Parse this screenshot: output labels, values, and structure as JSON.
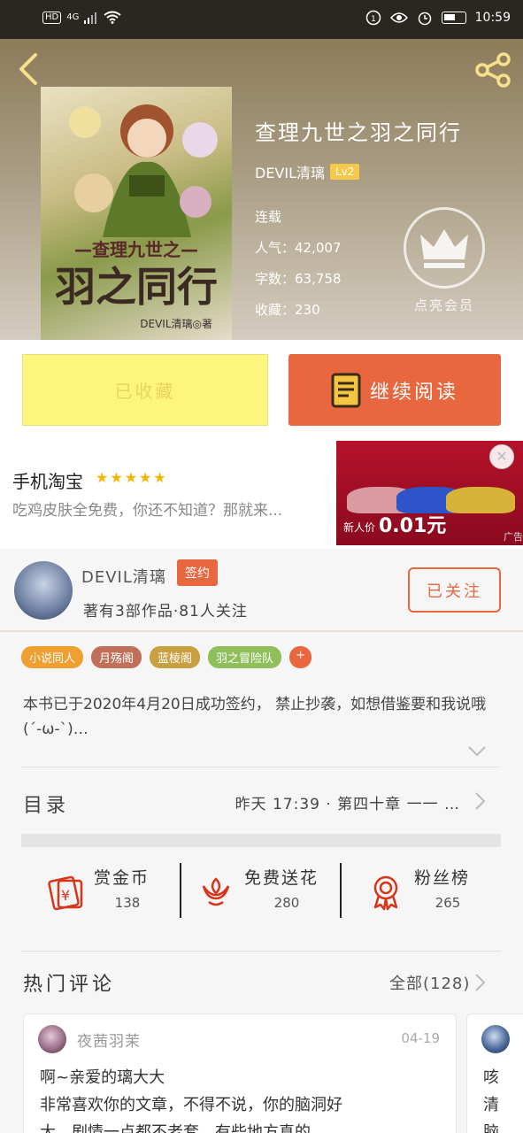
{
  "status_bar": {
    "left": [
      "HD",
      "4G"
    ],
    "time": "10:59"
  },
  "book": {
    "title": "查理九世之羽之同行",
    "author": "DEVIL清璃",
    "level": "Lv2",
    "status": "连载",
    "popularity": "人气：42,007",
    "word_count": "字数：63,758",
    "favorites": "收藏：230",
    "vip_label": "点亮会员",
    "cover": {
      "small_title": "—查理九世之—",
      "big_title": "羽之同行",
      "author": "DEVIL清璃◎著"
    }
  },
  "actions": {
    "collected_label": "已收藏",
    "read_label": "继续阅读"
  },
  "ad": {
    "app_name": "手机淘宝",
    "stars": "★★★★★",
    "description": "吃鸡皮肤全免费，你还不知道？那就来...",
    "newbie_label": "新人价",
    "price": "0.01元",
    "ad_tag": "广告",
    "close": "✕",
    "car_colors": [
      "#d99aa0",
      "#2d55c9",
      "#d9b23a"
    ]
  },
  "author_block": {
    "name": "DEVIL清璃",
    "signed_badge": "签约",
    "subtitle": "著有3部作品·81人关注",
    "follow_label": "已关注"
  },
  "tags": [
    {
      "label": "小说同人",
      "color": "#f0a030"
    },
    {
      "label": "月殇阁",
      "color": "#c0705a"
    },
    {
      "label": "蓝棱阁",
      "color": "#c9a040"
    },
    {
      "label": "羽之冒险队",
      "color": "#8fbf5a"
    },
    {
      "label": "+",
      "color": "#e8673f"
    }
  ],
  "description": "本书已于2020年4月20日成功签约， 禁止抄袭，如想借鉴要和我说哦(´-ω-`)…",
  "toc": {
    "label": "目录",
    "latest": "昨天 17:39 · 第四十章 一一 …"
  },
  "stats": [
    {
      "label": "赏金币",
      "value": "138"
    },
    {
      "label": "免费送花",
      "value": "280"
    },
    {
      "label": "粉丝榜",
      "value": "265"
    }
  ],
  "hot_comments": {
    "title": "热门评论",
    "all_label": "全部(128)",
    "comments": [
      {
        "user": "夜茜羽茉",
        "date": "04-19",
        "lines": [
          "啊~亲爱的璃大大",
          "非常喜欢你的文章，不得不说，你的脑洞好",
          "大，剧情一点都不老套，有些地方真的…"
        ]
      },
      {
        "user": "",
        "date": "",
        "lines": [
          "咳",
          "清",
          "脑"
        ]
      }
    ]
  },
  "colors": {
    "accent": "#e8673f",
    "collected_bg": "#fef57f"
  }
}
